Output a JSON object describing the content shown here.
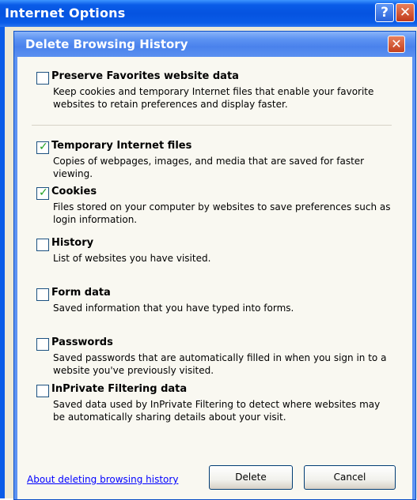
{
  "outer_window": {
    "title": "Internet Options",
    "help_glyph": "?",
    "close_glyph": "✕"
  },
  "dialog": {
    "title": "Delete Browsing History",
    "close_glyph": "✕",
    "items": [
      {
        "title": "Preserve Favorites website data",
        "checked": false,
        "desc": "Keep cookies and temporary Internet files that enable your favorite websites to retain preferences and display faster."
      },
      {
        "title": "Temporary Internet files",
        "checked": true,
        "desc": "Copies of webpages, images, and media that are saved for faster viewing."
      },
      {
        "title": "Cookies",
        "checked": true,
        "desc": "Files stored on your computer by websites to save preferences such as login information."
      },
      {
        "title": "History",
        "checked": false,
        "desc": "List of websites you have visited."
      },
      {
        "title": "Form data",
        "checked": false,
        "desc": "Saved information that you have typed into forms."
      },
      {
        "title": "Passwords",
        "checked": false,
        "desc": "Saved passwords that are automatically filled in when you sign in to a website you've previously visited."
      },
      {
        "title": "InPrivate Filtering data",
        "checked": false,
        "desc": "Saved data used by InPrivate Filtering to detect where websites may be automatically sharing details about your visit."
      }
    ],
    "link_text": "About deleting browsing history",
    "delete_label": "Delete",
    "cancel_label": "Cancel"
  },
  "colors": {
    "titlebar": "#0553e0",
    "dialog_titlebar": "#4a82ec",
    "link": "#0000ff",
    "check": "#21a121"
  }
}
